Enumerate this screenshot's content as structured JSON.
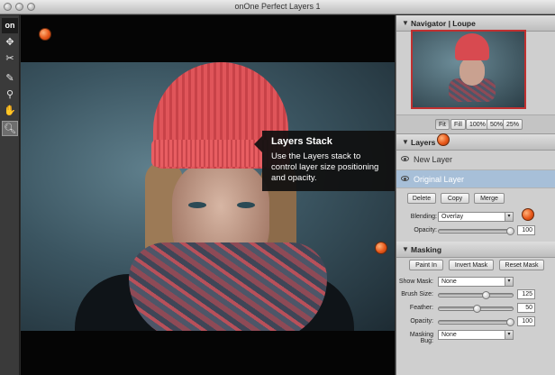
{
  "window": {
    "title": "onOne Perfect Layers 1"
  },
  "tools": [
    {
      "name": "logo",
      "glyph": "on"
    },
    {
      "name": "move",
      "glyph": "✥"
    },
    {
      "name": "scissors",
      "glyph": "✂"
    },
    {
      "name": "brush",
      "glyph": "✎"
    },
    {
      "name": "mask-bug",
      "glyph": "⚲"
    },
    {
      "name": "hand",
      "glyph": "✋"
    },
    {
      "name": "zoom",
      "glyph": "🔍︎"
    }
  ],
  "tooltip": {
    "title": "Layers Stack",
    "body": "Use the Layers stack to control layer size positioning and opacity."
  },
  "navigator": {
    "heading": "Navigator | Loupe",
    "zoom_buttons": [
      "Fit",
      "Fill",
      "100%",
      "50%",
      "25%"
    ],
    "selected_zoom": "Fit"
  },
  "layers": {
    "heading": "Layers",
    "items": [
      {
        "name": "New Layer",
        "selected": false
      },
      {
        "name": "Original Layer",
        "selected": true
      }
    ],
    "buttons": [
      "Delete",
      "Copy",
      "Merge"
    ],
    "blending_label": "Blending:",
    "blending_value": "Overlay",
    "opacity_label": "Opacity:",
    "opacity_value": "100"
  },
  "masking": {
    "heading": "Masking",
    "buttons": [
      "Paint In",
      "Invert Mask",
      "Reset Mask"
    ],
    "show_mask_label": "Show Mask:",
    "show_mask_value": "None",
    "brush_size_label": "Brush Size:",
    "brush_size_value": "125",
    "feather_label": "Feather:",
    "feather_value": "50",
    "opacity_label": "Opacity:",
    "opacity_value": "100",
    "masking_bug_label": "Masking Bug:",
    "masking_bug_value": "None"
  },
  "colors": {
    "accent_dot": "#e8581a",
    "selection": "#a7bfd8"
  }
}
